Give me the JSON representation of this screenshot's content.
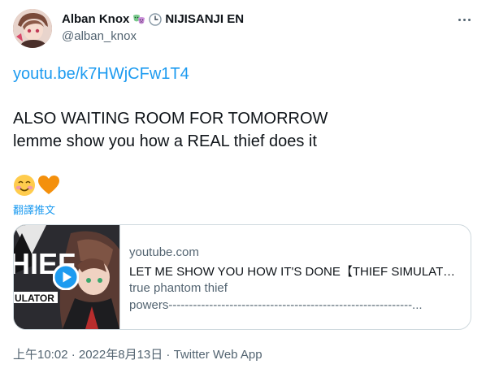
{
  "author": {
    "name": "Alban Knox",
    "affiliation": "NIJISANJI EN",
    "handle": "@alban_knox",
    "name_emojis": [
      "theater-masks-emoji",
      "clock-emoji"
    ]
  },
  "tweet": {
    "link_text": "youtu.be/k7HWjCFw1T4",
    "line1": "ALSO WAITING ROOM FOR TOMORROW",
    "line2": "lemme show you how a REAL thief does it",
    "emojis": [
      "smiling-face-emoji",
      "orange-heart-emoji"
    ],
    "translate_label": "翻譯推文"
  },
  "card": {
    "thumbnail_text": "HIEF",
    "thumbnail_subtext": "ULATOR",
    "domain": "youtube.com",
    "title": "LET ME SHOW YOU HOW IT'S DONE【THIEF SIMULATOR】",
    "description_line1": "true phantom thief",
    "description_line2": "powers------------------------------------------------------------..."
  },
  "meta": {
    "text": "上午10:02 · 2022年8月13日 · Twitter Web App"
  },
  "colors": {
    "link": "#1d9bf0",
    "secondary_text": "#536471",
    "border": "#cfd9de",
    "play_button": "#1d9bf0"
  }
}
